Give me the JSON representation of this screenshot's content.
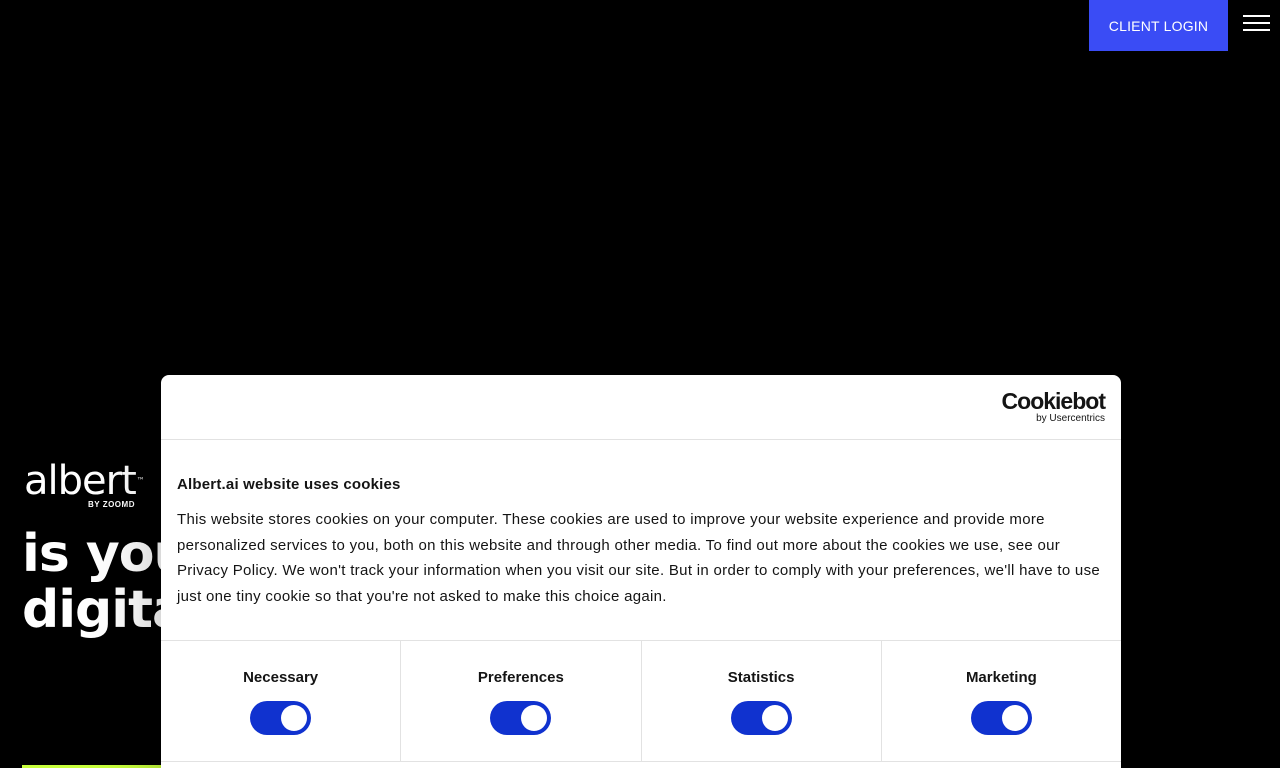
{
  "header": {
    "client_login_label": "CLIENT LOGIN",
    "menu_icon": "hamburger-menu-icon",
    "accent_color": "#3a4cf5"
  },
  "hero": {
    "logo_text": "albert",
    "logo_tm": "™",
    "logo_sub": "BY ZOOMD",
    "line1": "is your",
    "line2": "digital"
  },
  "cookie_dialog": {
    "brand": "Cookiebot",
    "brand_sub": "by Usercentrics",
    "title": "Albert.ai website uses cookies",
    "text": "This website stores cookies on your computer. These cookies are used to improve your website experience and provide more personalized services to you, both on this website and through other media. To find out more about the cookies we use, see our Privacy Policy. We won't track your information when you visit our site. But in order to comply with your preferences, we'll have to use just one tiny cookie so that you're not asked to make this choice again.",
    "toggle_color": "#1032cf",
    "categories": [
      {
        "label": "Necessary",
        "enabled": true
      },
      {
        "label": "Preferences",
        "enabled": true
      },
      {
        "label": "Statistics",
        "enabled": true
      },
      {
        "label": "Marketing",
        "enabled": true
      }
    ]
  }
}
